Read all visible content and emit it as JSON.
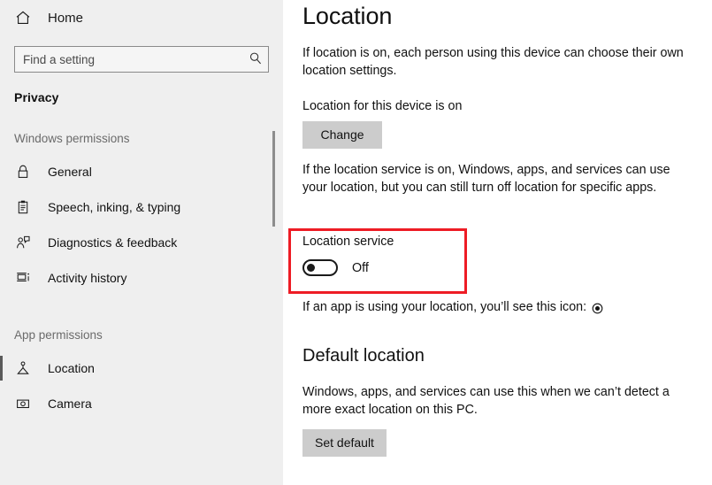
{
  "sidebar": {
    "home": {
      "label": "Home",
      "icon": "home-icon"
    },
    "search": {
      "placeholder": "Find a setting",
      "value": "",
      "icon": "search-icon"
    },
    "category_title": "Privacy",
    "groups": [
      {
        "label": "Windows permissions",
        "items": [
          {
            "label": "General",
            "icon": "lock-icon",
            "selected": false
          },
          {
            "label": "Speech, inking, & typing",
            "icon": "clipboard-icon",
            "selected": false
          },
          {
            "label": "Diagnostics & feedback",
            "icon": "person-feedback-icon",
            "selected": false
          },
          {
            "label": "Activity history",
            "icon": "timeline-icon",
            "selected": false
          }
        ]
      },
      {
        "label": "App permissions",
        "items": [
          {
            "label": "Location",
            "icon": "location-pin-icon",
            "selected": true
          },
          {
            "label": "Camera",
            "icon": "camera-icon",
            "selected": false
          }
        ]
      }
    ],
    "scrollbar": {
      "visible": true
    }
  },
  "main": {
    "page_title": "Location",
    "intro_paragraph": "If location is on, each person using this device can choose their own location settings.",
    "device_status": "Location for this device is on",
    "change_button": "Change",
    "service_paragraph": "If the location service is on, Windows, apps, and services can use your location, but you can still turn off location for specific apps.",
    "location_service": {
      "caption": "Location service",
      "state_label": "Off",
      "is_on": false
    },
    "icon_note": "If an app is using your location, you’ll see this icon:",
    "default_location": {
      "heading": "Default location",
      "paragraph": "Windows, apps, and services can use this when we can’t detect a more exact location on this PC.",
      "button": "Set default"
    }
  },
  "highlight": {
    "color": "#ee1c25",
    "target": "location-service-toggle"
  },
  "colors": {
    "sidebar_bg": "#efefef",
    "main_bg": "#ffffff",
    "text": "#111111",
    "muted_text": "#6b6b6b",
    "button_bg": "#cccccc",
    "accent_highlight": "#ee1c25",
    "selection_bar": "#5a5a5a"
  }
}
